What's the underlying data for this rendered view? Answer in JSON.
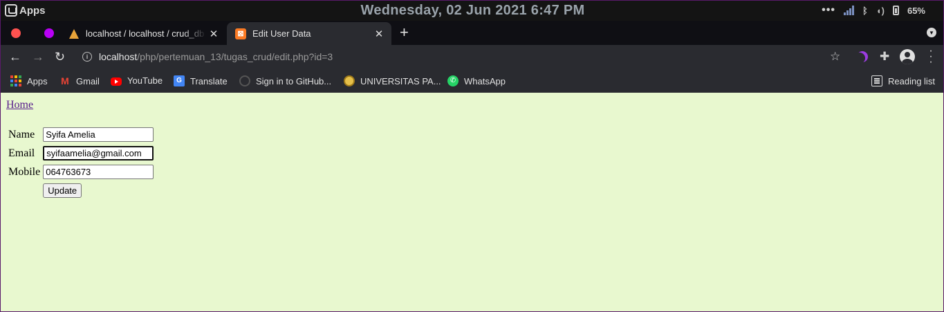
{
  "os_bar": {
    "apps_label": "Apps",
    "clock": "Wednesday, 02 Jun 2021  6:47 PM",
    "more_dots": "•••",
    "battery_percent": "65%"
  },
  "tabs": [
    {
      "title": "localhost / localhost / crud_db",
      "active": false
    },
    {
      "title": "Edit User Data",
      "active": true
    }
  ],
  "tab_close_glyph": "✕",
  "new_tab_glyph": "+",
  "toolbar": {
    "back_glyph": "←",
    "forward_glyph": "→",
    "reload_glyph": "↻",
    "url_host": "localhost",
    "url_path": "/php/pertemuan_13/tugas_crud/edit.php?id=3",
    "star_glyph": "☆",
    "extensions_glyph": "✚"
  },
  "bookmarks": [
    {
      "label": "Apps",
      "icon": "apps-grid-icon"
    },
    {
      "label": "Gmail",
      "icon": "gmail-icon"
    },
    {
      "label": "YouTube",
      "icon": "youtube-icon"
    },
    {
      "label": "Translate",
      "icon": "translate-icon"
    },
    {
      "label": "Sign in to GitHub...",
      "icon": "github-icon"
    },
    {
      "label": "UNIVERSITAS PA...",
      "icon": "university-icon"
    },
    {
      "label": "WhatsApp",
      "icon": "whatsapp-icon"
    }
  ],
  "reading_list": "Reading list",
  "page": {
    "home_link": "Home",
    "form": {
      "name_label": "Name",
      "name_value": "Syifa Amelia",
      "email_label": "Email",
      "email_value": "syifaamelia@gmail.com",
      "mobile_label": "Mobile",
      "mobile_value": "064763673",
      "submit_label": "Update"
    },
    "background_color": "#e8f8cf"
  }
}
